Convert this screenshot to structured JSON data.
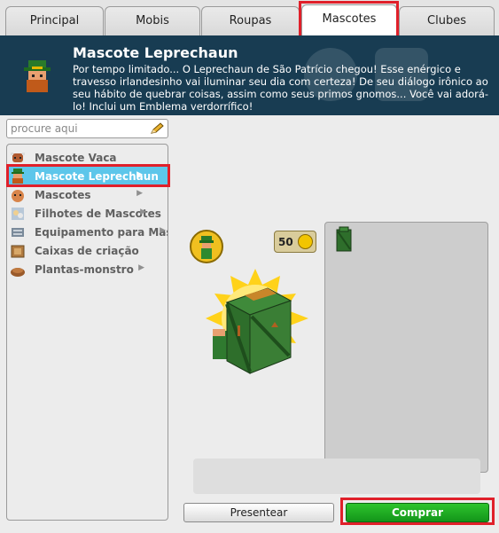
{
  "tabs": [
    {
      "label": "Principal",
      "active": false
    },
    {
      "label": "Mobis",
      "active": false
    },
    {
      "label": "Roupas",
      "active": false
    },
    {
      "label": "Mascotes",
      "active": true
    },
    {
      "label": "Clubes",
      "active": false
    }
  ],
  "header": {
    "title": "Mascote Leprechaun",
    "description": "Por tempo limitado... O Leprechaun de São Patrício chegou! Esse enérgico e travesso irlandesinho vai iluminar seu dia com certeza! De seu diálogo irônico ao seu hábito de quebrar coisas, assim como seus primos gnomos... Você vai adorá-lo! Inclui um Emblema verdorrífico!"
  },
  "search": {
    "placeholder": "procure aqui",
    "value": ""
  },
  "sidebar": {
    "items": [
      {
        "label": "Mascote Vaca",
        "icon": "cow-icon",
        "arrow": false,
        "selected": false
      },
      {
        "label": "Mascote Leprechaun",
        "icon": "leprechaun-icon",
        "arrow": true,
        "selected": true
      },
      {
        "label": "Mascotes",
        "icon": "pet-icon",
        "arrow": true,
        "selected": false
      },
      {
        "label": "Filhotes de Mascotes",
        "icon": "baby-pets-icon",
        "arrow": true,
        "selected": false
      },
      {
        "label": "Equipamento para Mascotes",
        "icon": "pet-equipment-icon",
        "arrow": true,
        "selected": false
      },
      {
        "label": "Caixas de criação",
        "icon": "breeding-box-icon",
        "arrow": false,
        "selected": false
      },
      {
        "label": "Plantas-monstro",
        "icon": "monster-plant-icon",
        "arrow": true,
        "selected": false
      }
    ]
  },
  "product": {
    "price": "50",
    "currency_icon": "credit-coin-icon"
  },
  "buttons": {
    "gift": "Presentear",
    "buy": "Comprar"
  },
  "colors": {
    "header_bg": "#183c52",
    "selected_item": "#5dc6ea",
    "buy_green": "#1ca31f",
    "highlight_red": "#e0202a"
  }
}
